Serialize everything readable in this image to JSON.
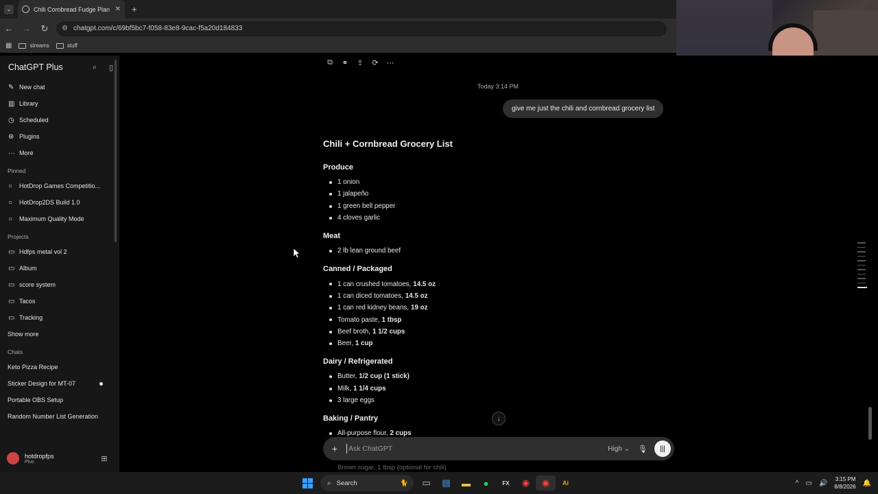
{
  "browser": {
    "tab_title": "Chili Cornbread Fudge Plan",
    "tab_list_icon": "⌄",
    "url": "chatgpt.com/c/69bf5bc7-f058-83e8-9cac-f5a20d184833",
    "bookmarks": [
      "streams",
      "stuff"
    ]
  },
  "sidebar": {
    "brand": "ChatGPT Plus",
    "nav": [
      {
        "icon": "✎",
        "label": "New chat"
      },
      {
        "icon": "▥",
        "label": "Library"
      },
      {
        "icon": "◷",
        "label": "Scheduled"
      },
      {
        "icon": "⊛",
        "label": "Plugins"
      },
      {
        "icon": "···",
        "label": "More"
      }
    ],
    "pinned_title": "Pinned",
    "pinned": [
      "HotDrop Games Competitio...",
      "HotDrop2DS Build 1.0",
      "Maximum Quality Mode"
    ],
    "projects_title": "Projects",
    "projects": [
      "Hdfps metal vol 2",
      "Album",
      "score system",
      "Tacos",
      "Tracking"
    ],
    "show_more": "Show more",
    "chats_title": "Chats",
    "chats": [
      "Keto Pizza Recipe",
      "Sticker Design for MT-07",
      "Portable OBS Setup",
      "Random Number List Generation"
    ],
    "user_name": "hotdropfps",
    "user_plan": "Plus"
  },
  "conversation": {
    "timestamp": "Today 3:14 PM",
    "user_message": "give me just the chili and cornbread grocery list",
    "answer_title": "Chili + Cornbread Grocery List",
    "sections": [
      {
        "title": "Produce",
        "items": [
          {
            "text": "1 onion",
            "bold": ""
          },
          {
            "text": "1 jalapeño",
            "bold": ""
          },
          {
            "text": "1 green bell pepper",
            "bold": ""
          },
          {
            "text": "4 cloves garlic",
            "bold": ""
          }
        ]
      },
      {
        "title": "Meat",
        "items": [
          {
            "text": "2 lb lean ground beef",
            "bold": ""
          }
        ]
      },
      {
        "title": "Canned / Packaged",
        "items": [
          {
            "text": "1 can crushed tomatoes,",
            "bold": "14.5 oz"
          },
          {
            "text": "1 can diced tomatoes,",
            "bold": "14.5 oz"
          },
          {
            "text": "1 can red kidney beans,",
            "bold": "19 oz"
          },
          {
            "text": "Tomato paste,",
            "bold": "1 tbsp"
          },
          {
            "text": "Beef broth,",
            "bold": "1 1/2 cups"
          },
          {
            "text": "Beer,",
            "bold": "1 cup"
          }
        ]
      },
      {
        "title": "Dairy / Refrigerated",
        "items": [
          {
            "text": "Butter,",
            "bold": "1/2 cup (1 stick)"
          },
          {
            "text": "Milk,",
            "bold": "1 1/4 cups"
          },
          {
            "text": "3 large eggs",
            "bold": ""
          }
        ]
      },
      {
        "title": "Baking / Pantry",
        "items": [
          {
            "text": "All-purpose flour,",
            "bold": "2 cups"
          }
        ]
      }
    ],
    "faded_line": "Brown sugar, 1 tbsp (optional for chili)"
  },
  "composer": {
    "placeholder": "Ask ChatGPT",
    "model_label": "High"
  },
  "taskbar": {
    "search_label": "Search",
    "time": "3:15 PM",
    "date": "8/8/2026"
  },
  "colors": {
    "background": "#000000",
    "sidebar": "#171717",
    "bubble": "#2f2f2f",
    "windows_blue": "#3aa0ff"
  }
}
